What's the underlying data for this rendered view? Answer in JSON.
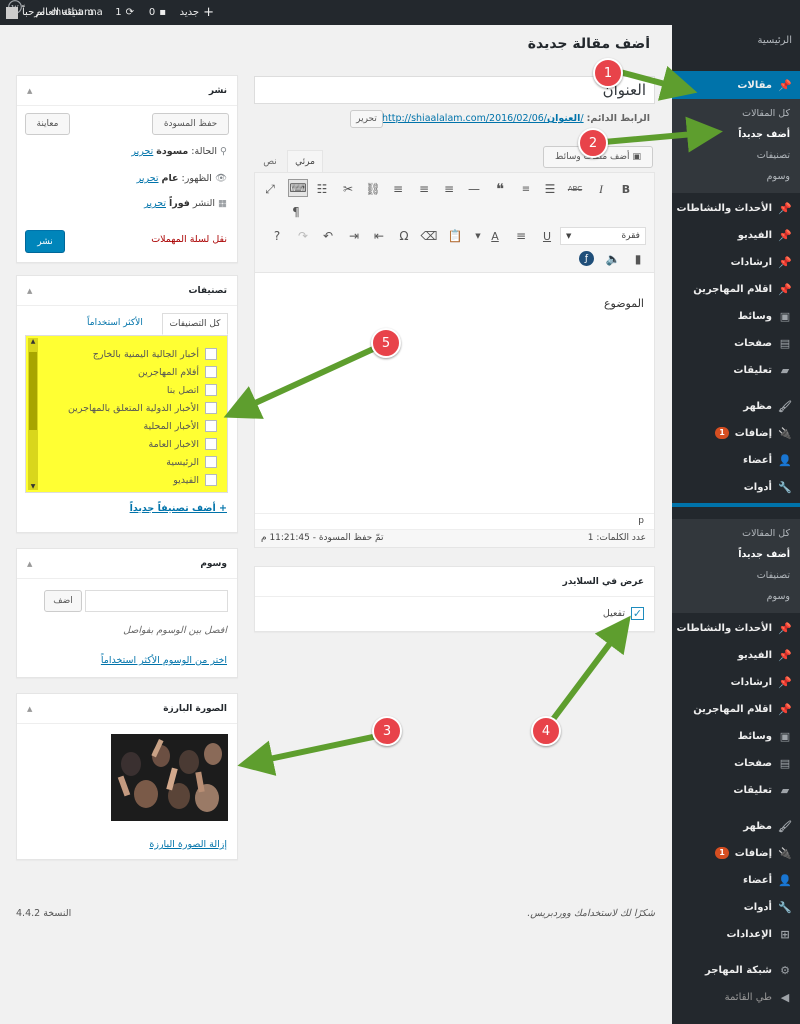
{
  "topbar": {
    "site_name": "شيعة العالم",
    "updates_count": "1",
    "comments_count": "0",
    "new_label": "جديد",
    "greeting": "مرحباً، muthanna"
  },
  "page_title": "أضف مقالة جديدة",
  "post": {
    "title_value": "العنوان",
    "permalink_label": "الرابط الدائم:",
    "permalink_base": "http://shiaalalam.com/2016/02/06/",
    "permalink_slug": "العنوان",
    "edit_button": "تحرير",
    "add_media": "أضف ملفات وسائط",
    "tab_visual": "مرئي",
    "tab_text": "نص",
    "format_select": "فقرة",
    "body_text": "الموضوع",
    "path": "p",
    "word_count": "عدد الكلمات: 1",
    "draft_saved": "تمّ حفظ المسودة - 11:21:45 م"
  },
  "slider_box": {
    "title": "عرض في السلايدر",
    "checkbox_label": "تفعيل",
    "checked": true
  },
  "publish_box": {
    "title": "نشر",
    "save_draft": "حفظ المسودة",
    "preview": "معاينة",
    "status_label": "الحالة:",
    "status_value": "مسودة",
    "edit1": "تحرير",
    "visibility_label": "الظهور:",
    "visibility_value": "عام",
    "edit2": "تحرير",
    "schedule_label": "النشر",
    "schedule_value": "فوراً",
    "edit3": "تحرير",
    "trash": "نقل لسلة المهملات",
    "publish": "نشر"
  },
  "categories_box": {
    "title": "تصنيفات",
    "tab_all": "كل التصنيفات",
    "tab_popular": "الأكثر استخداماً",
    "items": [
      "أخبار الجالية اليمنية بالخارج",
      "أفلام المهاجرين",
      "اتصل بنا",
      "الأخبار الدولية المتعلق بالمهاجرين",
      "الأخبار المحلية",
      "الاخبار العامة",
      "الرئيسية",
      "الفيديو"
    ],
    "add_new": "+ أضف تصنيفاً جديداً"
  },
  "tags_box": {
    "title": "وسوم",
    "add_button": "اضف",
    "hint": "افصل بين الوسوم بفواصل",
    "popular_link": "اختر من الوسوم الأكثر استخداماً"
  },
  "featured_box": {
    "title": "الصورة البارزة",
    "remove_link": "إزالة الصورة البارزة"
  },
  "footer": {
    "thanks": "شكرًا لك لاستخدامك ووردبريس.",
    "version": "النسخة 4.4.2"
  },
  "sidebar": {
    "top_cut": "الرئيسية",
    "menu": [
      {
        "label": "مقالات",
        "icon": "pin-icon"
      },
      {
        "label": "الأحداث والنشاطات",
        "icon": "pin-icon"
      },
      {
        "label": "الفيديو",
        "icon": "pin-icon"
      },
      {
        "label": "ارشادات",
        "icon": "pin-icon"
      },
      {
        "label": "اقلام المهاجرين",
        "icon": "pin-icon"
      },
      {
        "label": "وسائط",
        "icon": "media-icon"
      },
      {
        "label": "صفحات",
        "icon": "page-icon"
      },
      {
        "label": "تعليقات",
        "icon": "comment-icon"
      },
      {
        "label": "مظهر",
        "icon": "brush-icon"
      },
      {
        "label": "إضافات",
        "icon": "plugin-icon",
        "badge": "1"
      },
      {
        "label": "أعضاء",
        "icon": "user-icon"
      },
      {
        "label": "أدوات",
        "icon": "wrench-icon"
      },
      {
        "label": "الإعدادات",
        "icon": "settings-icon"
      },
      {
        "label": "شبكة المهاجر",
        "icon": "gear-icon"
      },
      {
        "label": "طي القائمة",
        "icon": "collapse-icon"
      }
    ],
    "submenu": [
      "كل المقالات",
      "أضف جديداً",
      "تصنيفات",
      "وسوم"
    ]
  },
  "markers": [
    "1",
    "2",
    "3",
    "4",
    "5"
  ],
  "colors": {
    "accent": "#0073aa",
    "admin_bar": "#23282d",
    "arrow": "#5e9e2e",
    "marker": "#e8434a",
    "highlight": "#ffff33"
  }
}
